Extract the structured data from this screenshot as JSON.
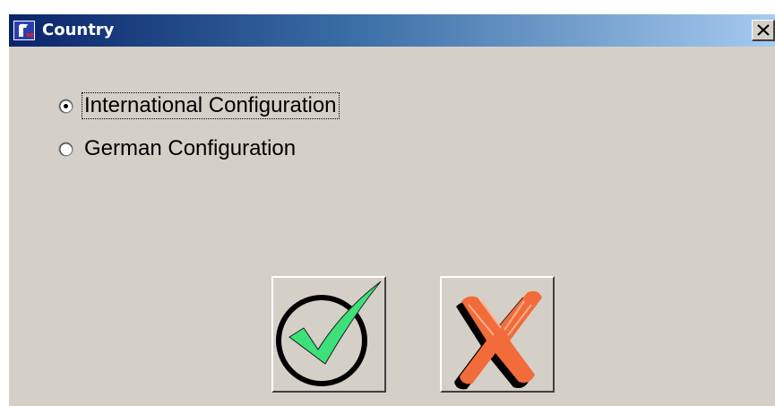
{
  "window": {
    "title": "Country",
    "close_glyph": "✕"
  },
  "options": [
    {
      "label": "International Configuration",
      "selected": true,
      "focused": true
    },
    {
      "label": "German Configuration",
      "selected": false,
      "focused": false
    }
  ],
  "buttons": {
    "ok_icon": "green-checkmark-circle-icon",
    "cancel_icon": "red-x-icon"
  },
  "colors": {
    "titlebar_start": "#0a246a",
    "titlebar_end": "#a6caf0",
    "dialog_background": "#d4d0c8",
    "check_green": "#3ee07a",
    "x_orange": "#f26b3a"
  }
}
